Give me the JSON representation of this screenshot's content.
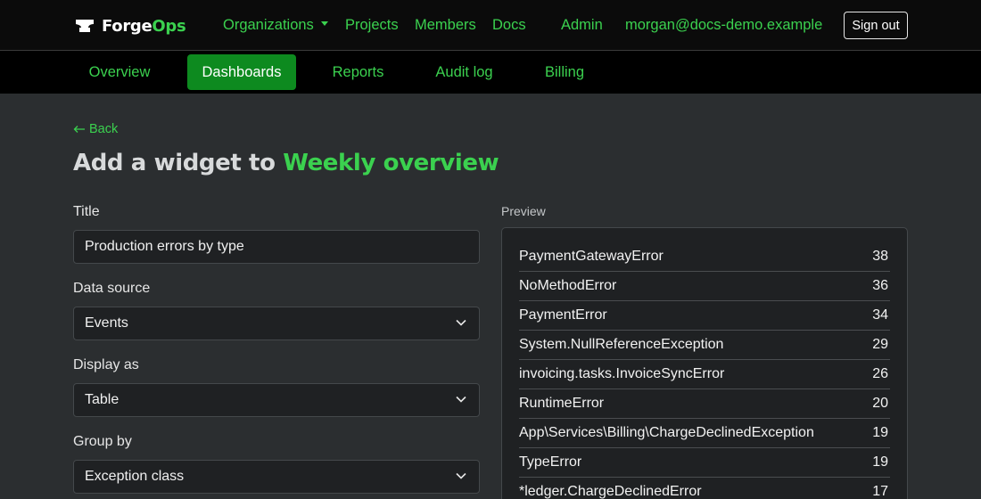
{
  "brand": {
    "forge": "Forge",
    "ops": "Ops"
  },
  "topnav": {
    "organizations": "Organizations",
    "projects": "Projects",
    "members": "Members",
    "docs": "Docs",
    "admin": "Admin",
    "user_email": "morgan@docs-demo.example",
    "sign_out": "Sign out"
  },
  "subnav": {
    "tabs": [
      "Overview",
      "Dashboards",
      "Reports",
      "Audit log",
      "Billing"
    ],
    "active": "Dashboards"
  },
  "page": {
    "back": "Back",
    "title_prefix": "Add a widget to ",
    "title_dashboard": "Weekly overview"
  },
  "form": {
    "title_label": "Title",
    "title_value": "Production errors by type",
    "data_source_label": "Data source",
    "data_source_value": "Events",
    "display_as_label": "Display as",
    "display_as_value": "Table",
    "group_by_label": "Group by",
    "group_by_value": "Exception class"
  },
  "preview": {
    "label": "Preview",
    "rows": [
      {
        "name": "PaymentGatewayError",
        "count": "38"
      },
      {
        "name": "NoMethodError",
        "count": "36"
      },
      {
        "name": "PaymentError",
        "count": "34"
      },
      {
        "name": "System.NullReferenceException",
        "count": "29"
      },
      {
        "name": "invoicing.tasks.InvoiceSyncError",
        "count": "26"
      },
      {
        "name": "RuntimeError",
        "count": "20"
      },
      {
        "name": "App\\Services\\Billing\\ChargeDeclinedException",
        "count": "19"
      },
      {
        "name": "TypeError",
        "count": "19"
      },
      {
        "name": "*ledger.ChargeDeclinedError",
        "count": "17"
      }
    ]
  },
  "colors": {
    "accent": "#3bd14f",
    "active_tab": "#0d8a1f",
    "background": "#2b2e30",
    "topbar": "#0b0b0b"
  }
}
